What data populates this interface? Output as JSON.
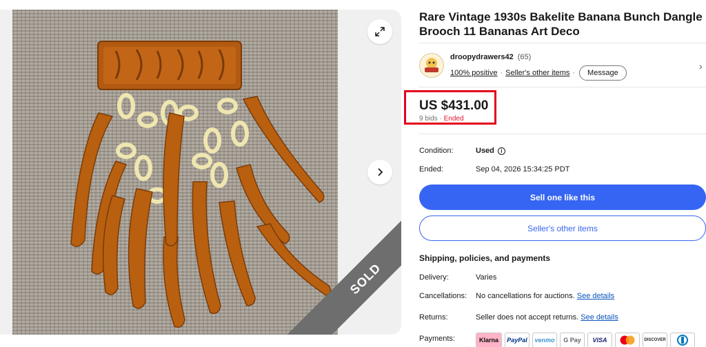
{
  "listing": {
    "title": "Rare Vintage 1930s Bakelite Banana Bunch Dangle Brooch 11 Bananas Art Deco",
    "sold_label": "SOLD"
  },
  "seller": {
    "name": "droopydrawers42",
    "count": "(65)",
    "positive": "100% positive",
    "other_items_link": "Seller's other items",
    "message_label": "Message"
  },
  "price": {
    "amount": "US $431.00",
    "bids": "9 bids",
    "status": "Ended",
    "separator": "·"
  },
  "details": {
    "condition_label": "Condition:",
    "condition_value": "Used",
    "ended_label": "Ended:",
    "ended_value": "Sep 04, 2026 15:34:25 PDT"
  },
  "actions": {
    "sell_one_like_this": "Sell one like this",
    "sellers_other_items": "Seller's other items"
  },
  "shipping": {
    "section_title": "Shipping, policies, and payments",
    "delivery_label": "Delivery:",
    "delivery_value": "Varies",
    "cancellations_label": "Cancellations:",
    "cancellations_value": "No cancellations for auctions.",
    "cancellations_link": "See details",
    "returns_label": "Returns:",
    "returns_value": "Seller does not accept returns.",
    "returns_link": "See details",
    "payments_label": "Payments:"
  },
  "payments": [
    "Klarna",
    "PayPal",
    "venmo",
    "G Pay",
    "VISA",
    "",
    "DISCOVER",
    ""
  ],
  "colors": {
    "primary_button": "#3665f3",
    "highlight_box": "#e3001b",
    "ended": "#e0102f",
    "link": "#0654ba"
  }
}
